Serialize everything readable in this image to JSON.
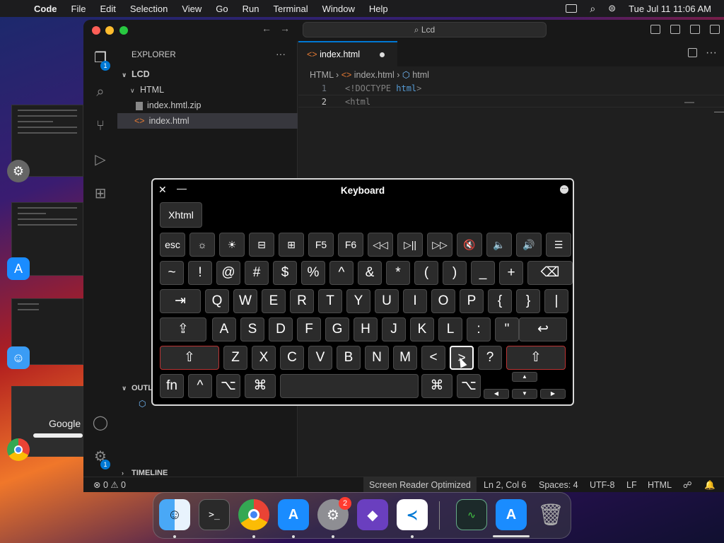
{
  "menubar": {
    "app": "Code",
    "items": [
      "File",
      "Edit",
      "Selection",
      "View",
      "Go",
      "Run",
      "Terminal",
      "Window",
      "Help"
    ],
    "datetime": "Tue Jul 11  11:06 AM"
  },
  "window": {
    "search": "Lcd"
  },
  "sidebar": {
    "header": "EXPLORER",
    "root": "LCD",
    "folder": "HTML",
    "files": [
      "index.hmtl.zip",
      "index.html"
    ],
    "outline": "OUTL",
    "timeline": "TIMELINE"
  },
  "editor": {
    "tab": "index.html",
    "breadcrumb": [
      "HTML",
      "index.html",
      "html"
    ],
    "lines": [
      {
        "num": "1",
        "a": "<!DOCTYPE ",
        "b": "html",
        "c": ">"
      },
      {
        "num": "2",
        "a": "<",
        "b": "html",
        "c": ""
      }
    ]
  },
  "activity_badges": {
    "explorer": "1",
    "settings": "1"
  },
  "statusbar": {
    "problems": "⊗ 0 ⚠ 0",
    "screen_reader": "Screen Reader Optimized",
    "position": "Ln 2, Col 6",
    "spaces": "Spaces: 4",
    "encoding": "UTF-8",
    "eol": "LF",
    "language": "HTML"
  },
  "keyboard": {
    "title": "Keyboard",
    "suggestion": "Xhtml",
    "row0": [
      "esc",
      "☼",
      "☀",
      "⊟",
      "⊞",
      "F5",
      "F6",
      "◁◁",
      "▷||",
      "▷▷",
      "🔇",
      "🔈",
      "🔊",
      "☰"
    ],
    "row1": [
      "~",
      "!",
      "@",
      "#",
      "$",
      "%",
      "^",
      "&",
      "*",
      "(",
      ")",
      "_",
      "+",
      "⌫"
    ],
    "row2": [
      "⇥",
      "Q",
      "W",
      "E",
      "R",
      "T",
      "Y",
      "U",
      "I",
      "O",
      "P",
      "{",
      "}",
      "|"
    ],
    "row3": [
      "⇪",
      "A",
      "S",
      "D",
      "F",
      "G",
      "H",
      "J",
      "K",
      "L",
      ":",
      "\"",
      "↩"
    ],
    "row4": [
      "⇧",
      "Z",
      "X",
      "C",
      "V",
      "B",
      "N",
      "M",
      "<",
      ">",
      "?",
      "⇧"
    ],
    "row5": [
      "fn",
      "^",
      "⌥",
      "⌘",
      "",
      "⌘",
      "⌥"
    ]
  },
  "dock": {
    "settings_badge": "2",
    "apps": [
      "Finder",
      "Terminal",
      "Chrome",
      "App Store",
      "System Settings",
      "Visual Studio",
      "VS Code",
      "Activity Monitor",
      "App Store",
      "Trash"
    ]
  },
  "thumbnails": {
    "google": "Google"
  },
  "colors": {
    "accent": "#0078d4",
    "keyboard_bg": "#000000"
  }
}
